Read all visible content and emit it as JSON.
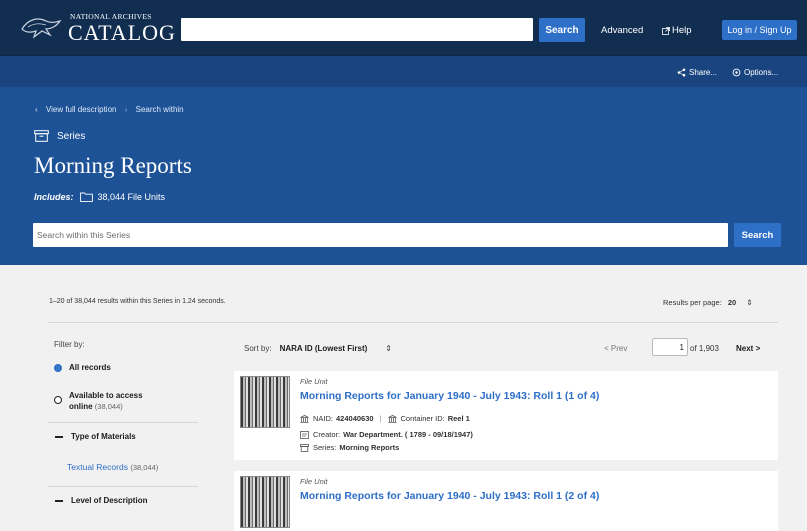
{
  "header": {
    "logo_small": "NATIONAL ARCHIVES",
    "logo_big": "CATALOG",
    "search_placeholder": "",
    "search_button": "Search",
    "advanced": "Advanced",
    "help": "Help",
    "login": "Log in / Sign Up"
  },
  "subbar": {
    "share": "Share...",
    "options": "Options..."
  },
  "hero": {
    "breadcrumb_back": "View full description",
    "breadcrumb_current": "Search within",
    "level": "Series",
    "title": "Morning Reports",
    "includes_label": "Includes:",
    "includes_value": "38,044 File Units",
    "within_placeholder": "Search within this Series",
    "within_button": "Search"
  },
  "results": {
    "info": "1–20 of 38,044 results within this Series in 1.24 seconds.",
    "per_page_label": "Results per page:",
    "per_page_value": "20"
  },
  "filters": {
    "label": "Filter by:",
    "all_records": "All records",
    "available_line1": "Available to access",
    "available_line2": "online",
    "available_count": "(38,044)",
    "type_of_materials": "Type of Materials",
    "textual_records": "Textual Records",
    "textual_count": "(38,044)",
    "level_of_description": "Level of Description"
  },
  "sort": {
    "label": "Sort by:",
    "value": "NARA ID (Lowest First)"
  },
  "pagination": {
    "prev": "< Prev",
    "page": "1",
    "of": "of 1,903",
    "next": "Next >"
  },
  "cards": [
    {
      "kind": "File Unit",
      "title": "Morning Reports for January 1940 - July 1943: Roll 1 (1 of 4)",
      "naid_label": "NAID:",
      "naid": "424040630",
      "container_label": "Container ID:",
      "container": "Reel 1",
      "creator_label": "Creator:",
      "creator": "War Department. ( 1789 - 09/18/1947)",
      "series_label": "Series:",
      "series": "Morning Reports"
    },
    {
      "kind": "File Unit",
      "title": "Morning Reports for January 1940 - July 1943: Roll 1 (2 of 4)"
    }
  ]
}
